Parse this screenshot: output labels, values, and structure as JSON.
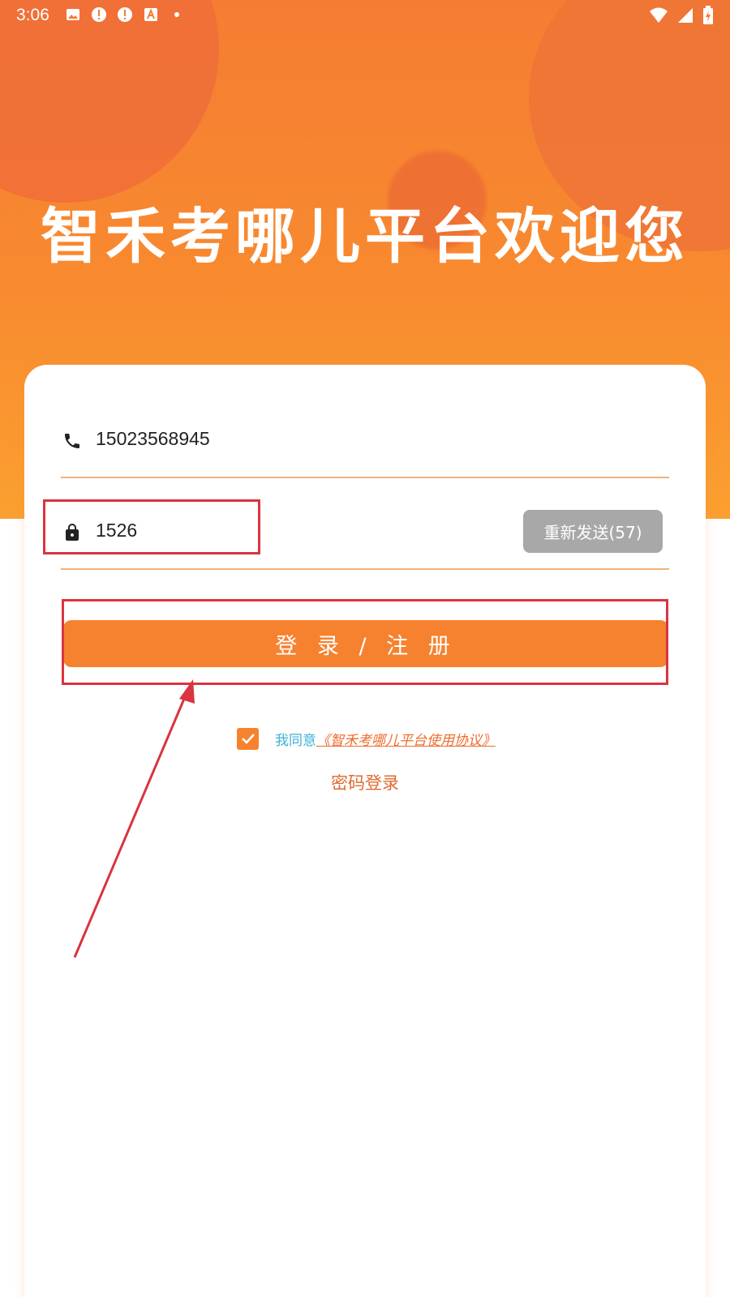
{
  "status_bar": {
    "time": "3:06",
    "left_icons": [
      "image-icon",
      "alert-icon",
      "alert-icon",
      "font-icon",
      "dot-icon"
    ],
    "right_icons": [
      "wifi-icon",
      "signal-icon",
      "battery-charging-icon"
    ]
  },
  "header": {
    "title": "智禾考哪儿平台欢迎您"
  },
  "form": {
    "phone_value": "15023568945",
    "code_value": "1526",
    "resend_label": "重新发送(57)",
    "login_label": "登 录 / 注 册"
  },
  "agreement": {
    "prefix": "我同意",
    "link_text": "《智禾考哪儿平台使用协议》",
    "checked": true
  },
  "alt_login": {
    "label": "密码登录"
  },
  "colors": {
    "accent": "#f6822f",
    "annotation": "#d9343f",
    "agree_text": "#3bb3d6",
    "link": "#f06c2c",
    "resend_bg": "#a8a8a8"
  }
}
